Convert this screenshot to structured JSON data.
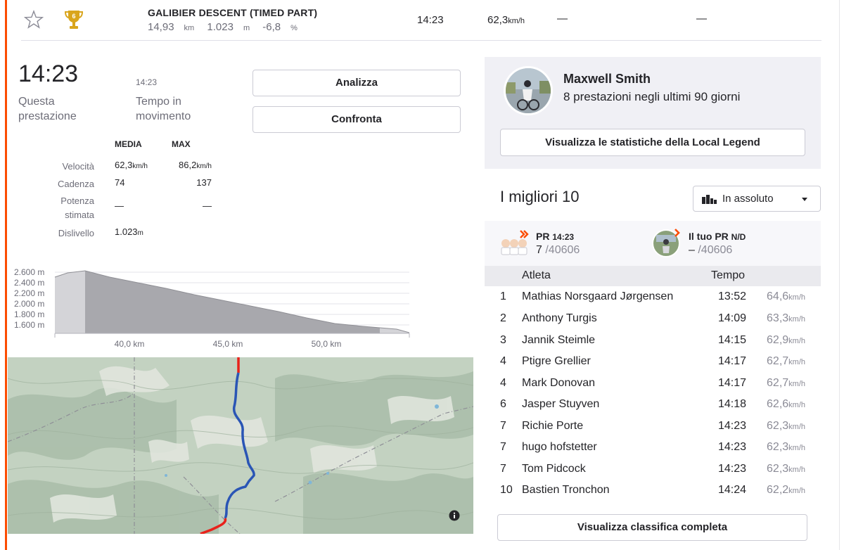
{
  "segment": {
    "name": "GALIBIER DESCENT (TIMED PART)",
    "distance": "14,93",
    "distance_unit": "km",
    "elevation": "1.023",
    "elevation_unit": "m",
    "grade": "-6,8",
    "grade_unit": "%",
    "time": "14:23",
    "speed": "62,3",
    "speed_unit": "km/h",
    "col5": "—",
    "col6": "—",
    "trophy_rank": "6"
  },
  "effort": {
    "time": "14:23",
    "time_label": "Questa prestazione",
    "moving_time": "14:23",
    "moving_label": "Tempo in movimento",
    "analyze_label": "Analizza",
    "compare_label": "Confronta"
  },
  "stats": {
    "header_avg": "MEDIA",
    "header_max": "MAX",
    "rows": [
      {
        "label": "Velocità",
        "avg": "62,3",
        "avg_unit": "km/h",
        "max": "86,2",
        "max_unit": "km/h"
      },
      {
        "label": "Cadenza",
        "avg": "74",
        "avg_unit": "",
        "max": "137",
        "max_unit": ""
      },
      {
        "label": "Potenza stimata",
        "avg": "—",
        "avg_unit": "",
        "max": "—",
        "max_unit": ""
      },
      {
        "label": "Dislivello",
        "avg": "1.023",
        "avg_unit": "m",
        "max": "",
        "max_unit": ""
      }
    ]
  },
  "elevation_chart": {
    "y_ticks": [
      "2.600 m",
      "2.400 m",
      "2.200 m",
      "2.000 m",
      "1.800 m",
      "1.600 m"
    ],
    "x_ticks": [
      "40,0 km",
      "45,0 km",
      "50,0 km"
    ]
  },
  "local_legend": {
    "name": "Maxwell Smith",
    "subtitle": "8 prestazioni negli ultimi 90 giorni",
    "button_label": "Visualizza le statistiche della Local Legend"
  },
  "leaderboard": {
    "title": "I migliori 10",
    "filter": "In assoluto",
    "pr_title": "PR",
    "pr_time": "14:23",
    "pr_rank": "7",
    "pr_total": "/40606",
    "your_pr_title": "Il tuo PR",
    "your_pr_time": "N/D",
    "your_pr_rank": "–",
    "your_pr_total": "/40606",
    "col_athlete": "Atleta",
    "col_time": "Tempo",
    "rows": [
      {
        "rank": "1",
        "name": "Mathias Norsgaard Jørgensen",
        "time": "13:52",
        "speed": "64,6"
      },
      {
        "rank": "2",
        "name": "Anthony Turgis",
        "time": "14:09",
        "speed": "63,3"
      },
      {
        "rank": "3",
        "name": "Jannik Steimle",
        "time": "14:15",
        "speed": "62,9"
      },
      {
        "rank": "4",
        "name": "Ptigre Grellier",
        "time": "14:17",
        "speed": "62,7"
      },
      {
        "rank": "4",
        "name": "Mark Donovan",
        "time": "14:17",
        "speed": "62,7"
      },
      {
        "rank": "6",
        "name": "Jasper Stuyven",
        "time": "14:18",
        "speed": "62,6"
      },
      {
        "rank": "7",
        "name": "Richie Porte",
        "time": "14:23",
        "speed": "62,3"
      },
      {
        "rank": "7",
        "name": "hugo hofstetter",
        "time": "14:23",
        "speed": "62,3"
      },
      {
        "rank": "7",
        "name": "Tom Pidcock",
        "time": "14:23",
        "speed": "62,3"
      },
      {
        "rank": "10",
        "name": "Bastien Tronchon",
        "time": "14:24",
        "speed": "62,2"
      }
    ],
    "speed_unit": "km/h",
    "full_button": "Visualizza classifica completa"
  },
  "colors": {
    "accent": "#fc4c02",
    "route_blue": "#2a55b5",
    "route_red": "#e8221b",
    "trophy": "#d9a51c"
  },
  "icons": {
    "star": "star-icon",
    "trophy": "trophy-icon",
    "filter": "bar-chart-icon",
    "caret": "chevron-down-icon",
    "info": "info-icon"
  }
}
